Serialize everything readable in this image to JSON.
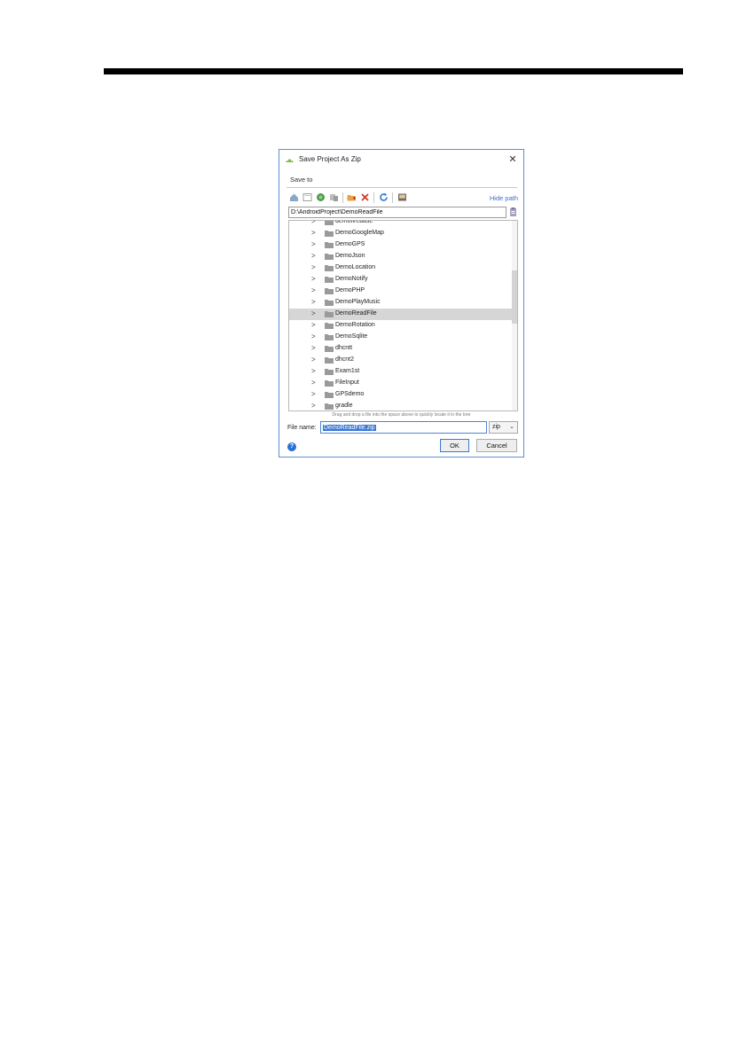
{
  "dialog": {
    "title": "Save Project As Zip",
    "save_to_label": "Save to",
    "hide_path_label": "Hide path",
    "path_value": "D:\\AndroidProject\\DemoReadFile",
    "toolbar_icons": [
      "home-icon",
      "desktop-icon",
      "project-icon",
      "module-icon",
      "new-folder-icon",
      "delete-icon",
      "refresh-icon",
      "show-hidden-icon"
    ],
    "tree_items": [
      {
        "label": "demofirebase",
        "selected": false
      },
      {
        "label": "DemoGoogleMap",
        "selected": false
      },
      {
        "label": "DemoGPS",
        "selected": false
      },
      {
        "label": "DemoJson",
        "selected": false
      },
      {
        "label": "DemoLocation",
        "selected": false
      },
      {
        "label": "DemoNotify",
        "selected": false
      },
      {
        "label": "DemoPHP",
        "selected": false
      },
      {
        "label": "DemoPlayMusic",
        "selected": false
      },
      {
        "label": "DemoReadFile",
        "selected": true
      },
      {
        "label": "DemoRotation",
        "selected": false
      },
      {
        "label": "DemoSqlite",
        "selected": false
      },
      {
        "label": "dhcntt",
        "selected": false
      },
      {
        "label": "dhcnt2",
        "selected": false
      },
      {
        "label": "Exam1st",
        "selected": false
      },
      {
        "label": "FileInput",
        "selected": false
      },
      {
        "label": "GPSdemo",
        "selected": false
      },
      {
        "label": "gradle",
        "selected": false
      }
    ],
    "drag_hint": "Drag and drop a file into the space above to quickly locate it in the tree",
    "file_name_label": "File name:",
    "file_name_value": "DemoReadFile.zip",
    "extension_value": "zip",
    "ok_label": "OK",
    "cancel_label": "Cancel",
    "colors": {
      "accent": "#3a78d4",
      "selected_row": "#d6d6d6",
      "folder": "#9a9a9a",
      "link": "#3a6fc9"
    }
  }
}
